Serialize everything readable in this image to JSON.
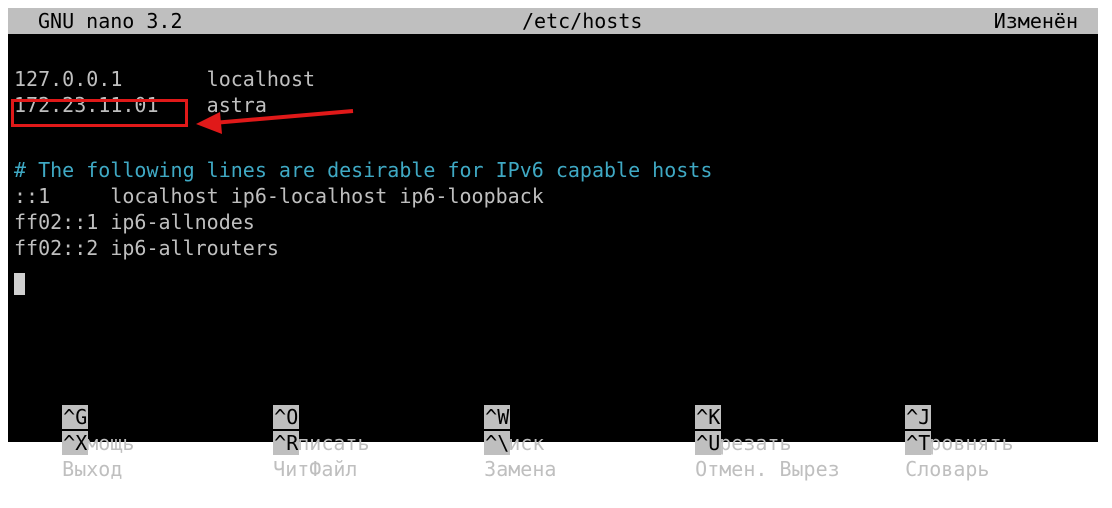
{
  "titlebar": {
    "app": "GNU nano 3.2",
    "file": "/etc/hosts",
    "status": "Изменён"
  },
  "lines": [
    "127.0.0.1       localhost",
    "172.23.11.01    astra",
    "",
    "# The following lines are desirable for IPv6 capable hosts",
    "::1     localhost ip6-localhost ip6-loopback",
    "ff02::1 ip6-allnodes",
    "ff02::2 ip6-allrouters"
  ],
  "shortcuts": {
    "row1": [
      {
        "key": "^G",
        "label": "Помощь"
      },
      {
        "key": "^O",
        "label": "Записать"
      },
      {
        "key": "^W",
        "label": "Поиск"
      },
      {
        "key": "^K",
        "label": "Вырезать"
      },
      {
        "key": "^J",
        "label": "Выровнять"
      }
    ],
    "row2": [
      {
        "key": "^X",
        "label": "Выход"
      },
      {
        "key": "^R",
        "label": "ЧитФайл"
      },
      {
        "key": "^\\",
        "label": "Замена"
      },
      {
        "key": "^U",
        "label": "Отмен. Вырез"
      },
      {
        "key": "^T",
        "label": "Словарь"
      }
    ]
  },
  "colors": {
    "background": "#000000",
    "text": "#bfbfbf",
    "comment": "#3fa9c4",
    "titlebar_bg": "#bfbfbf",
    "highlight": "#e01919"
  }
}
